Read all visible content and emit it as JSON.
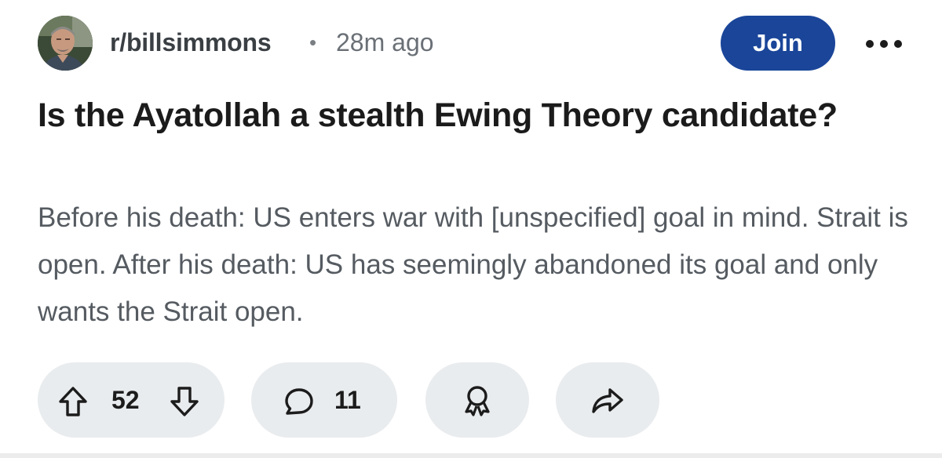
{
  "post": {
    "subreddit": "r/billsimmons",
    "separator": "•",
    "time_ago": "28m ago",
    "join_label": "Join",
    "title": "Is the Ayatollah a stealth Ewing Theory candidate?",
    "body": "Before his death: US enters war with [unspecified] goal in mind. Strait is open. After his death: US has seemingly abandoned its goal and only wants the Strait open."
  },
  "actions": {
    "upvote_icon": "arrow-up-icon",
    "vote_count": "52",
    "downvote_icon": "arrow-down-icon",
    "comment_icon": "speech-bubble-icon",
    "comment_count": "11",
    "award_icon": "award-ribbon-icon",
    "share_icon": "share-arrow-icon",
    "more_icon": "more-horizontal-icon"
  },
  "colors": {
    "join_button": "#1a4599",
    "pill_background": "#e9ecee",
    "body_text": "#555b61",
    "title_text": "#1b1b1b"
  }
}
